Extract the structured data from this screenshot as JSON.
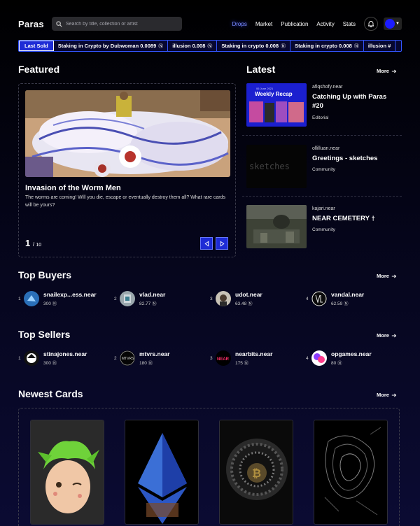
{
  "header": {
    "logo": "Paras",
    "search_placeholder": "Search by title, collection or artist",
    "nav": [
      "Drops",
      "Market",
      "Publication",
      "Activity",
      "Stats"
    ],
    "active_nav": "Drops"
  },
  "ticker": {
    "label": "Last Sold",
    "items": [
      {
        "title": "Staking in Crypto by Dubwoman",
        "price": "0.0089"
      },
      {
        "title": "illusion",
        "price": "0.008"
      },
      {
        "title": "Staking in crypto",
        "price": "0.008"
      },
      {
        "title": "Staking in crypto",
        "price": "0.008"
      },
      {
        "title": "illusion",
        "price": "#"
      }
    ]
  },
  "featured": {
    "heading": "Featured",
    "title": "Invasion of the Worm Men",
    "description": "The worms are coming! Will you die, escape or eventually destroy them all? What rare cards will be yours?",
    "page": "1",
    "total": "10"
  },
  "latest": {
    "heading": "Latest",
    "more": "More",
    "items": [
      {
        "author": "afiqshofy.near",
        "title": "Catching Up with Paras #20",
        "category": "Editorial",
        "thumb_banner": "Weekly Recap",
        "thumb_date": "06 June 2021"
      },
      {
        "author": "ollilluan.near",
        "title": "Greetings - sketches",
        "category": "Community",
        "thumb_text": "sketches"
      },
      {
        "author": "kajari.near",
        "title": "NEAR CEMETERY †",
        "category": "Community"
      }
    ]
  },
  "top_buyers": {
    "heading": "Top Buyers",
    "more": "More",
    "people": [
      {
        "rank": "1",
        "name": "snailexp...ess.near",
        "value": "300"
      },
      {
        "rank": "2",
        "name": "vlad.near",
        "value": "82.77"
      },
      {
        "rank": "3",
        "name": "udot.near",
        "value": "63.48"
      },
      {
        "rank": "4",
        "name": "vandal.near",
        "value": "62.59"
      }
    ]
  },
  "top_sellers": {
    "heading": "Top Sellers",
    "more": "More",
    "people": [
      {
        "rank": "1",
        "name": "stinajones.near",
        "value": "300"
      },
      {
        "rank": "2",
        "name": "mtvrs.near",
        "value": "180"
      },
      {
        "rank": "3",
        "name": "nearbits.near",
        "value": "175"
      },
      {
        "rank": "4",
        "name": "opgames.near",
        "value": "80"
      }
    ]
  },
  "newest_cards": {
    "heading": "Newest Cards",
    "more": "More"
  },
  "colors": {
    "accent": "#1d2bd6",
    "active_nav": "#7b8cff"
  }
}
